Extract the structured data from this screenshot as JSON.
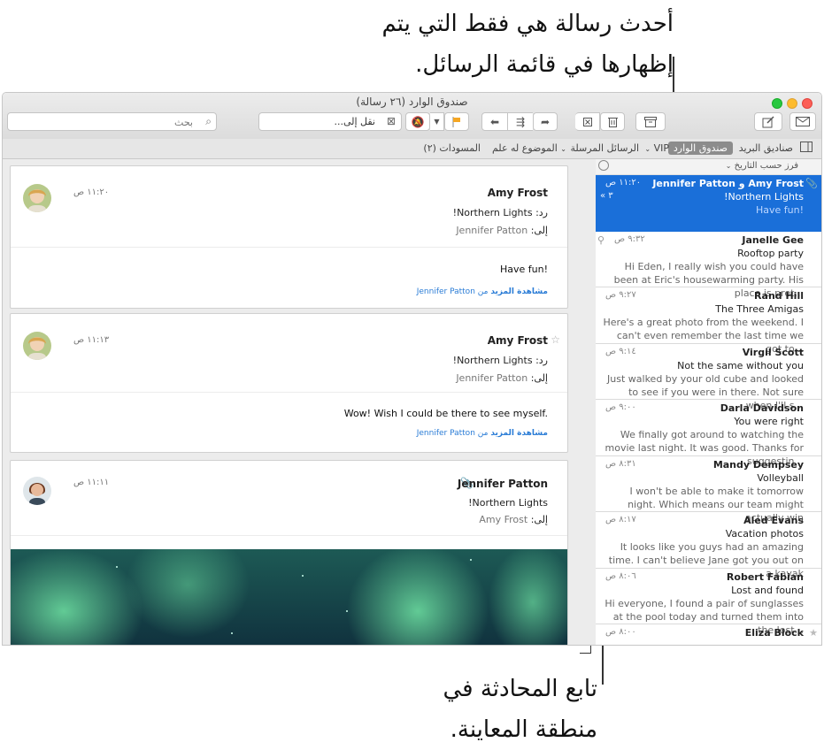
{
  "callouts": {
    "top_line1": "أحدث رسالة هي فقط التي يتم",
    "top_line2": "إظهارها في قائمة الرسائل.",
    "bottom_line1": "تابع المحادثة في",
    "bottom_line2": "منطقة المعاينة."
  },
  "window": {
    "title": "صندوق الوارد (٢٦ رسالة)"
  },
  "toolbar": {
    "search_placeholder": "بحث",
    "move_to_label": "نقل إلى..."
  },
  "favorites": {
    "mailboxes": "صناديق البريد",
    "inbox": "صندوق الوارد",
    "vip": "VIP",
    "sent": "الرسائل المرسلة",
    "flagged": "الموضوع له علم",
    "drafts": "المسودات (٢)"
  },
  "sort_label": "فرز حسب التاريخ",
  "messages": [
    {
      "from": "Amy Frost و Jennifer Patton",
      "time": "١١:٢٠ ص",
      "subject": "Northern Lights!",
      "preview": "Have fun!",
      "count": "« ٣",
      "selected": true
    },
    {
      "from": "Janelle Gee",
      "time": "٩:٣٢ ص",
      "subject": "Rooftop party",
      "preview": "Hi Eden, I really wish you could have been at Eric's housewarming party. His place is pret..."
    },
    {
      "from": "Rand Hill",
      "time": "٩:٢٧ ص",
      "subject": "The Three Amigas",
      "preview": "Here's a great photo from the weekend. I can't even remember the last time we got to..."
    },
    {
      "from": "Virgil Scott",
      "time": "٩:١٤ ص",
      "subject": "Not the same without you",
      "preview": "Just walked by your old cube and looked to see if you were in there. Not sure when I'll s..."
    },
    {
      "from": "Darla Davidson",
      "time": "٩:٠٠ ص",
      "subject": "You were right",
      "preview": "We finally got around to watching the movie last night. It was good. Thanks for suggestin..."
    },
    {
      "from": "Mandy Dempsey",
      "time": "٨:٣١ ص",
      "subject": "Volleyball",
      "preview": "I won't be able to make it tomorrow night. Which means our team might actually win"
    },
    {
      "from": "Aled Evans",
      "time": "٨:١٧ ص",
      "subject": "Vacation photos",
      "preview": "It looks like you guys had an amazing time. I can't believe Jane got you out on a kayak"
    },
    {
      "from": "Robert Fabian",
      "time": "٨:٠٦ ص",
      "subject": "Lost and found",
      "preview": "Hi everyone, I found a pair of sunglasses at the pool today and turned them into the lost..."
    },
    {
      "from": "Eliza Block",
      "time": "٨:٠٠ ص",
      "subject": "",
      "preview": ""
    }
  ],
  "conversation": [
    {
      "sender": "Amy Frost",
      "time": "١١:٢٠ ص",
      "re_key": "رد:",
      "re_value": "Northern Lights!",
      "to_key": "إلى:",
      "to_value": "Jennifer Patton",
      "body": "Have fun!",
      "more_link": "مشاهدة المزيد",
      "more_from": "من Jennifer Patton"
    },
    {
      "sender": "Amy Frost",
      "time": "١١:١٣ ص",
      "re_key": "رد:",
      "re_value": "Northern Lights!",
      "to_key": "إلى:",
      "to_value": "Jennifer Patton",
      "body": "Wow! Wish I could be there to see myself.",
      "more_link": "مشاهدة المزيد",
      "more_from": "من Jennifer Patton"
    },
    {
      "sender": "Jennifer Patton",
      "time": "١١:١١ ص",
      "subject": "Northern Lights!",
      "to_key": "إلى:",
      "to_value": "Amy Frost"
    }
  ],
  "colors": {
    "selection": "#1a6fd9",
    "link": "#2a7cd6",
    "flag": "#f5a623"
  }
}
